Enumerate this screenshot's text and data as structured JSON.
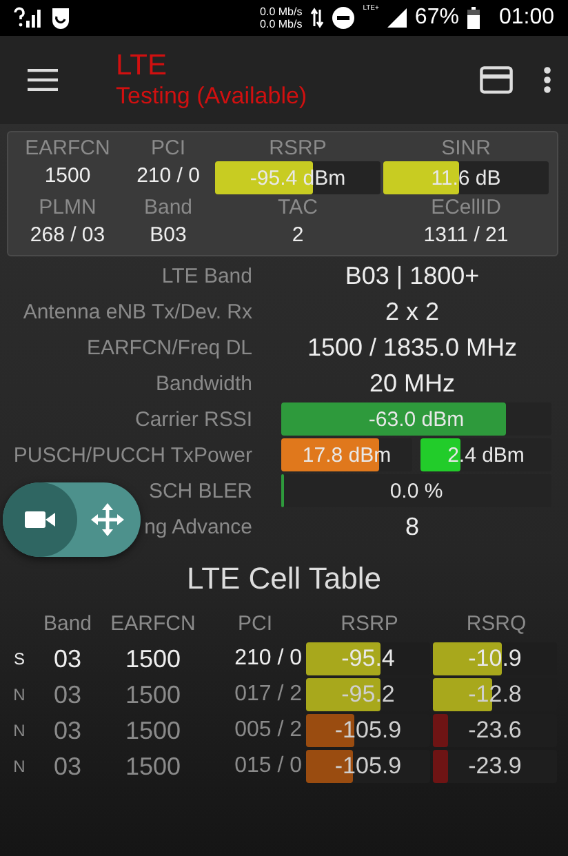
{
  "status_bar": {
    "speed_up": "0.0 Mb/s",
    "speed_down": "0.0 Mb/s",
    "network": "LTE+",
    "battery": "67%",
    "time": "01:00"
  },
  "toolbar": {
    "title": "LTE",
    "subtitle": "Testing (Available)"
  },
  "summary": {
    "rows": [
      [
        {
          "label": "EARFCN",
          "kind": "text",
          "value": "1500"
        },
        {
          "label": "PCI",
          "kind": "text",
          "value": "210 / 0"
        },
        {
          "label": "RSRP",
          "kind": "meter",
          "value": "-95.4 dBm",
          "level": 0.59,
          "color": "#c8cc22"
        },
        {
          "label": "SINR",
          "kind": "meter",
          "value": "11.6 dB",
          "level": 0.46,
          "color": "#c8cc22"
        }
      ],
      [
        {
          "label": "PLMN",
          "kind": "text",
          "value": "268 / 03"
        },
        {
          "label": "Band",
          "kind": "text",
          "value": "B03"
        },
        {
          "label": "TAC",
          "kind": "text",
          "value": "2"
        },
        {
          "label": "ECellID",
          "kind": "text",
          "value": "1311 / 21"
        }
      ]
    ]
  },
  "info": [
    {
      "label": "LTE Band",
      "kind": "text",
      "value": "B03 | 1800+"
    },
    {
      "label": "Antenna eNB Tx/Dev. Rx",
      "kind": "text",
      "value": "2 x 2"
    },
    {
      "label": "EARFCN/Freq DL",
      "kind": "text",
      "value": "1500 / 1835.0 MHz"
    },
    {
      "label": "Bandwidth",
      "kind": "text",
      "value": "20 MHz"
    },
    {
      "label": "Carrier RSSI",
      "kind": "meter",
      "meters": [
        {
          "value": "-63.0 dBm",
          "level": 0.83,
          "color": "#2e9a3c"
        }
      ]
    },
    {
      "label": "PUSCH/PUCCH TxPower",
      "kind": "meter",
      "meters": [
        {
          "value": "17.8 dBm",
          "level": 0.75,
          "color": "#e0781c"
        },
        {
          "value": "2.4 dBm",
          "level": 0.3,
          "color": "#22cc2a"
        }
      ]
    },
    {
      "label": "SCH BLER",
      "kind": "meter",
      "meters": [
        {
          "value": "0.0 %",
          "level": 0.01,
          "color": "#2e9a3c"
        }
      ]
    },
    {
      "label": "ng Advance",
      "kind": "text",
      "value": "8"
    }
  ],
  "cell_table": {
    "title": "LTE Cell Table",
    "columns": [
      "Band",
      "EARFCN",
      "PCI",
      "RSRP",
      "RSRQ"
    ],
    "rows": [
      {
        "type": "S",
        "active": true,
        "band": "03",
        "earfcn": "1500",
        "pci": "210 / 0",
        "rsrp": {
          "value": "-95.4",
          "level": 0.6,
          "color": "#a8a81c"
        },
        "rsrq": {
          "value": "-10.9",
          "level": 0.56,
          "color": "#a8a81c"
        }
      },
      {
        "type": "N",
        "active": false,
        "band": "03",
        "earfcn": "1500",
        "pci": "017 / 2",
        "rsrp": {
          "value": "-95.2",
          "level": 0.6,
          "color": "#a8a81c"
        },
        "rsrq": {
          "value": "-12.8",
          "level": 0.48,
          "color": "#a8a81c"
        }
      },
      {
        "type": "N",
        "active": false,
        "band": "03",
        "earfcn": "1500",
        "pci": "005 / 2",
        "rsrp": {
          "value": "-105.9",
          "level": 0.39,
          "color": "#9a4c10"
        },
        "rsrq": {
          "value": "-23.6",
          "level": 0.12,
          "color": "#6e1414"
        }
      },
      {
        "type": "N",
        "active": false,
        "band": "03",
        "earfcn": "1500",
        "pci": "015 / 0",
        "rsrp": {
          "value": "-105.9",
          "level": 0.38,
          "color": "#9a4c10"
        },
        "rsrq": {
          "value": "-23.9",
          "level": 0.12,
          "color": "#6e1414"
        }
      }
    ]
  }
}
